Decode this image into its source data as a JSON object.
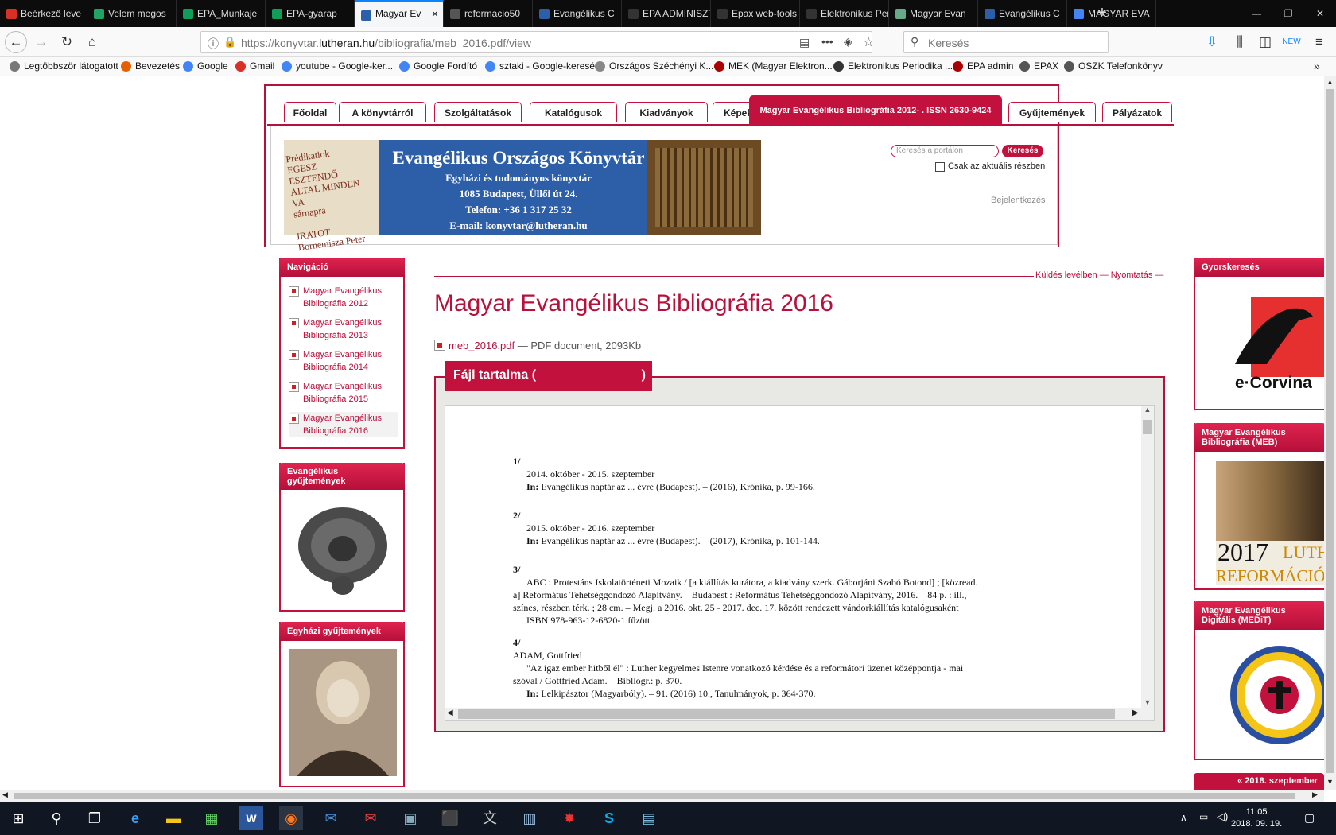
{
  "browser": {
    "tabs": [
      {
        "label": "Beérkező leve",
        "color": "#d93025"
      },
      {
        "label": "Velem megos",
        "color": "#1fa463"
      },
      {
        "label": "EPA_Munkaje",
        "color": "#0f9d58"
      },
      {
        "label": "EPA-gyarap",
        "color": "#0f9d58"
      },
      {
        "label": "Magyar Ev",
        "color": "#2d5ea8",
        "active": true
      },
      {
        "label": "reformacio50",
        "color": "#555"
      },
      {
        "label": "Evangélikus C",
        "color": "#2d5ea8"
      },
      {
        "label": "EPA ADMINISZTR",
        "color": "#333"
      },
      {
        "label": "Epax web-tools",
        "color": "#333"
      },
      {
        "label": "Elektronikus Peric",
        "color": "#333"
      },
      {
        "label": "Magyar Evan",
        "color": "#6a8"
      },
      {
        "label": "Evangélikus C",
        "color": "#2d5ea8"
      },
      {
        "label": "MAGYAR EVA",
        "color": "#4285f4"
      }
    ],
    "tab_close": "×",
    "new_tab": "+",
    "url_prefix": "https://konyvtar.",
    "url_domain": "lutheran.hu",
    "url_path": "/bibliografia/meb_2016.pdf/view",
    "search_placeholder": "Keresés",
    "bookmarks": [
      {
        "label": "Legtöbbször látogatott",
        "color": "#777"
      },
      {
        "label": "Bevezetés",
        "color": "#e66000"
      },
      {
        "label": "Google",
        "color": "#4285f4"
      },
      {
        "label": "Gmail",
        "color": "#d93025"
      },
      {
        "label": "youtube - Google-ker...",
        "color": "#4285f4"
      },
      {
        "label": "Google Fordító",
        "color": "#4285f4"
      },
      {
        "label": "sztaki - Google-keresés",
        "color": "#4285f4"
      },
      {
        "label": "Országos Széchényi K...",
        "color": "#888"
      },
      {
        "label": "MEK (Magyar Elektron...",
        "color": "#a00"
      },
      {
        "label": "Elektronikus Periodika ...",
        "color": "#333"
      },
      {
        "label": "EPA admin",
        "color": "#a00"
      },
      {
        "label": "EPAX",
        "color": "#555"
      },
      {
        "label": "OSZK Telefonkönyv",
        "color": "#555"
      }
    ]
  },
  "site": {
    "tabs": [
      "Főoldal",
      "A könyvtárról",
      "Szolgáltatások",
      "Katalógusok",
      "Kiadványok",
      "Képek",
      "Magyar Evangélikus Bibliográfia 2012- . ISSN 2630-9424",
      "Gyűjtemények",
      "Pályázatok"
    ],
    "banner_title": "Evangélikus Országos Könyvtár",
    "banner_lines": [
      "Egyházi és tudományos könyvtár",
      "1085 Budapest, Üllői út 24.",
      "Telefon: +36 1 317 25 32",
      "E-mail: konyvtar@lutheran.hu"
    ],
    "search_placeholder": "Keresés a portálon",
    "search_button": "Keresés",
    "checkbox_label": "Csak az aktuális részben",
    "login": "Bejelentkezés"
  },
  "left": {
    "nav_title": "Navigáció",
    "nav_items": [
      "Magyar Evangélikus Bibliográfia 2012",
      "Magyar Evangélikus Bibliográfia 2013",
      "Magyar Evangélikus Bibliográfia 2014",
      "Magyar Evangélikus Bibliográfia 2015",
      "Magyar Evangélikus Bibliográfia 2016"
    ],
    "coll_title": "Evangélikus gyűjtemények",
    "church_title": "Egyházi gyűjtemények"
  },
  "content": {
    "actions": "Küldés levélben — Nyomtatás —",
    "title": "Magyar Evangélikus Bibliográfia 2016",
    "file_link": "meb_2016.pdf",
    "file_meta": " — PDF document, 2093Kb",
    "file_box_title": "Fájl tartalma (",
    "file_box_close": ")",
    "entries": [
      {
        "num": "1/",
        "lines": [
          "2014. október - 2015. szeptember"
        ],
        "in_label": "In:",
        "in_text": " Evangélikus naptár az ... évre (Budapest). – (2016), Krónika, p. 99-166."
      },
      {
        "num": "2/",
        "lines": [
          "2015. október - 2016. szeptember"
        ],
        "in_label": "In:",
        "in_text": " Evangélikus naptár az ... évre (Budapest). – (2017), Krónika, p. 101-144."
      },
      {
        "num": "3/",
        "lines": [
          "ABC : Protestáns Iskolatörténeti Mozaik / [a kiállítás kurátora, a kiadvány szerk. Gáborjáni Szabó Botond] ; [közread."
        ],
        "cont": [
          "a] Református Tehetséggondozó Alapítvány. – Budapest : Református Tehetséggondozó Alapítvány, 2016. – 84 p. : ill.,",
          "színes, részben térk. ; 28 cm. – Megj. a 2016. okt. 25 - 2017. dec. 17. között rendezett vándorkiállítás katalógusaként"
        ],
        "isbn": "ISBN 978-963-12-6820-1 fűzött"
      },
      {
        "num": "4/",
        "author": "ADAM, Gottfried",
        "lines": [
          "\"Az igaz ember hitből él\" : Luther kegyelmes Istenre vonatkozó kérdése és a reformátori üzenet középpontja  - mai"
        ],
        "cont": [
          "szóval / Gottfried Adam. – Bibliogr.: p. 370."
        ],
        "in_label": "In:",
        "in_text": " Lelkipásztor (Magyarbóly). – 91. (2016) 10., Tanulmányok, p. 364-370."
      }
    ]
  },
  "right": {
    "quick_title": "Gyorskeresés",
    "ecorvina": "e·Corvina",
    "meb_title": "Magyar Evangélikus Bibliográfia (MEB)",
    "poster_year": "2017",
    "poster_luther": "LUTH",
    "poster_ref": "REFORMÁCIÓ",
    "medit_title": "Magyar Evangélikus Digitális (MEDiT)",
    "calendar": "« 2018. szeptember"
  },
  "taskbar": {
    "time": "11:05",
    "date": "2018. 09. 19."
  },
  "colors": {
    "accent": "#c3113d",
    "link": "#b7103a",
    "banner": "#2d5ea8"
  }
}
